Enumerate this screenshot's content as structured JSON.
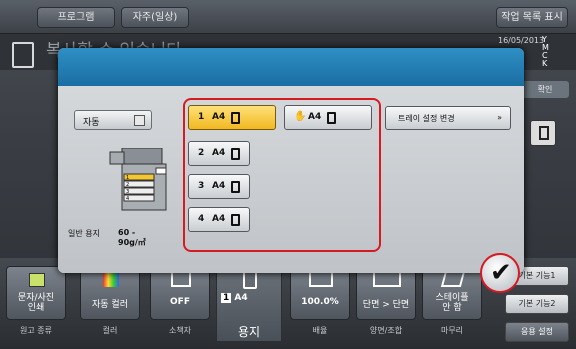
{
  "topbar": {
    "program_tab": "프로그램",
    "register_tab": "자주(일상)",
    "counter_tab": "작업 목록 표시"
  },
  "status": {
    "message": "복사할 수 있습니다",
    "date": "16/05/2013",
    "time": "",
    "toner": [
      "Y",
      "M",
      "C",
      "K"
    ],
    "confirm_label": "확인"
  },
  "dialog": {
    "auto_label": "자동",
    "paper_type": "일반 용지",
    "paper_weight_1": "60 -",
    "paper_weight_2": "90g/㎡",
    "trays": [
      {
        "num": "1",
        "size": "A4",
        "selected": true
      },
      {
        "num": "2",
        "size": "A4",
        "selected": false
      },
      {
        "num": "3",
        "size": "A4",
        "selected": false
      },
      {
        "num": "4",
        "size": "A4",
        "selected": false
      }
    ],
    "bypass": {
      "size": "A4"
    },
    "change_tray_label": "트레이 설정 변경",
    "change_tray_arrow": "»"
  },
  "bottombar": {
    "items": [
      {
        "value": "문자/사진\n인쇄",
        "label": "원고 종류"
      },
      {
        "value": "자동 컬러",
        "label": "컬러"
      },
      {
        "value": "OFF",
        "label": "소책자"
      },
      {
        "value": "100.0%",
        "label": "배율"
      },
      {
        "value": "단면 > 단면",
        "label": "양면/조합"
      },
      {
        "value": "스테이플\n안 함",
        "label": "마무리"
      }
    ],
    "paper_tab": {
      "tray": "1",
      "size": "A4",
      "label": "용지"
    },
    "right_buttons": [
      "기본 기능1",
      "기본 기능2",
      "응용 설정"
    ]
  },
  "colors": {
    "accent_red": "#d61a22",
    "selected_yellow": "#f0b820",
    "dialog_header": "#1a6ea3"
  }
}
